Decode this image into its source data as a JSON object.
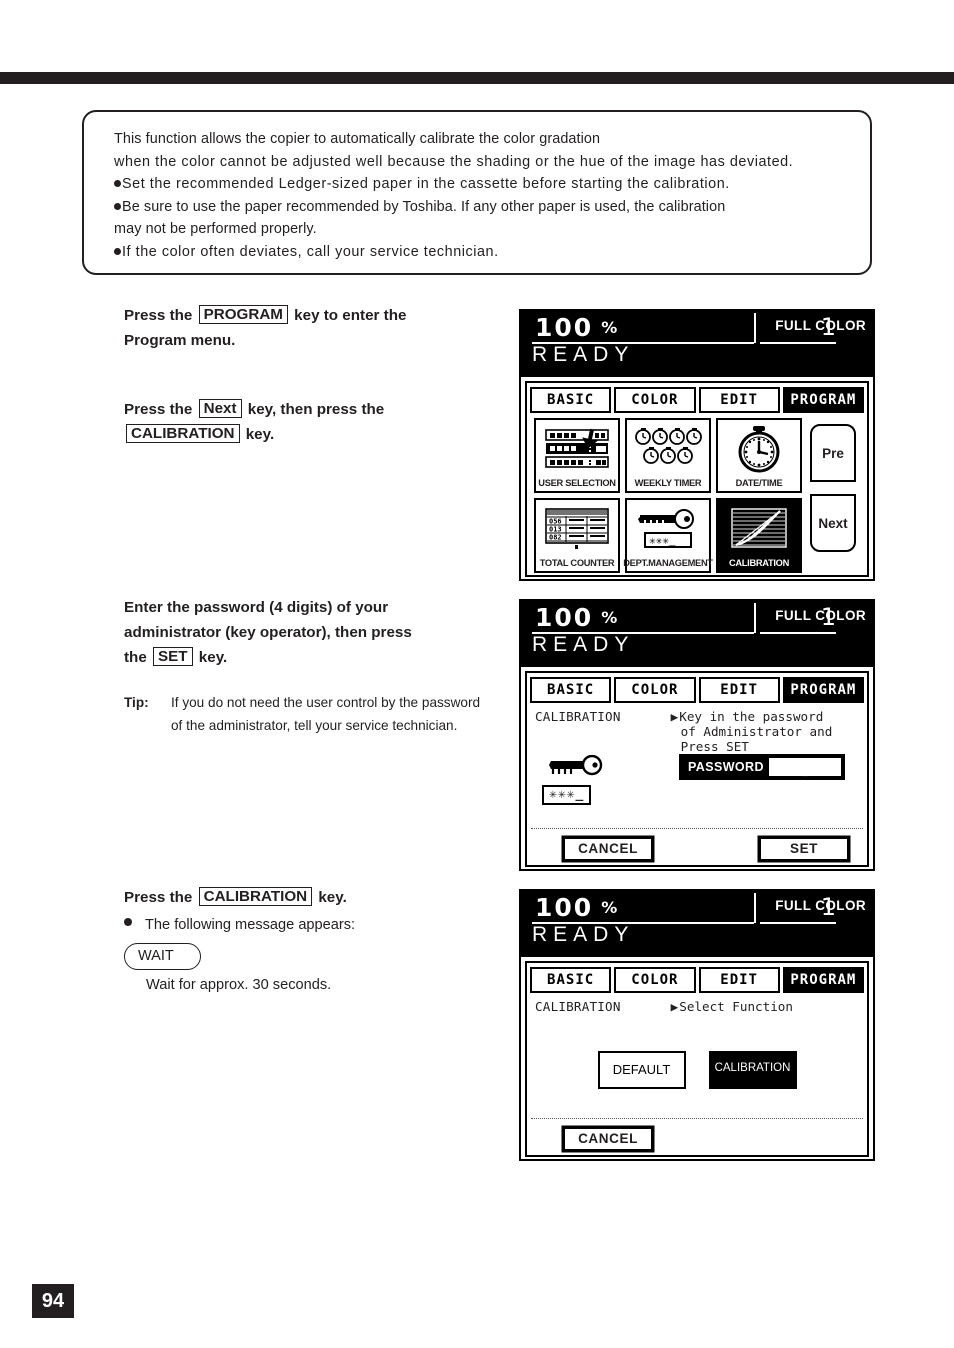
{
  "page": {
    "number": "94"
  },
  "intro": {
    "lines": [
      "This function allows the copier to automatically calibrate the color gradation",
      "when the color cannot be adjusted well because the shading or the hue of the image has deviated."
    ],
    "bullets": [
      "Set the recommended Ledger-sized paper in the cassette before starting the calibration.",
      "Be sure to use the paper recommended by Toshiba. If any other paper is used, the calibration",
      " may not be performed properly.",
      "If the color often deviates, call your service technician."
    ]
  },
  "steps": {
    "step1": {
      "pre": "Press  the",
      "key": "PROGRAM",
      "post": "key  to  enter  the",
      "line2": "Program menu."
    },
    "step2": {
      "pre": "Press  the",
      "key": "Next",
      "post": "key,  then  press  the",
      "key2": "CALIBRATION",
      "post2": "key."
    },
    "step3": {
      "line1": "Enter  the  password  (4  digits)  of  your",
      "line2": "administrator  (key  operator),  then  press",
      "line3_pre": "the",
      "line3_key": "SET",
      "line3_post": "key.",
      "tip_label": "Tip:",
      "tip_body": "If you do not need the user control by the password of the administrator, tell your service technician."
    },
    "step4": {
      "pre": "Press  the",
      "key": "CALIBRATION",
      "post": "key.",
      "bullet": "The  following  message  appears:",
      "wait_pill": "WAIT",
      "wait_note": "Wait  for  approx.  30  seconds."
    }
  },
  "lcd": {
    "common": {
      "zoom": "100",
      "percent": "%",
      "copies": "1",
      "color_mode": "FULL COLOR",
      "status": "READY",
      "tabs": [
        {
          "label": "BASIC",
          "active": false
        },
        {
          "label": "COLOR",
          "active": false
        },
        {
          "label": "EDIT",
          "active": false
        },
        {
          "label": "PROGRAM",
          "active": true
        }
      ]
    },
    "panel1": {
      "cells": [
        {
          "label": "USER SELECTION",
          "icon": "user-selection-icon",
          "selected": false
        },
        {
          "label": "WEEKLY TIMER",
          "icon": "weekly-timer-icon",
          "selected": false
        },
        {
          "label": "DATE/TIME",
          "icon": "date-time-icon",
          "selected": false
        },
        {
          "label": "TOTAL COUNTER",
          "icon": "total-counter-icon",
          "selected": false
        },
        {
          "label": "DEPT.MANAGEMENT",
          "icon": "dept-management-icon",
          "selected": false
        },
        {
          "label": "CALIBRATION",
          "icon": "calibration-icon",
          "selected": true
        }
      ],
      "counter_values": [
        "056",
        "013",
        "082"
      ],
      "dept_mask": "✳✳✳_",
      "nav": {
        "prev": "Pre",
        "next": "Next"
      }
    },
    "panel2": {
      "title": "CALIBRATION",
      "message": [
        "Key in the password",
        "of Administrator and",
        "Press SET"
      ],
      "stars": "✳✳✳_",
      "password_label": "PASSWORD",
      "password_value": "_",
      "cancel": "CANCEL",
      "set": "SET"
    },
    "panel3": {
      "title": "CALIBRATION",
      "message": "Select Function",
      "buttons": [
        {
          "label": "DEFAULT",
          "selected": false
        },
        {
          "label": "CALIBRATION",
          "selected": true
        }
      ],
      "cancel": "CANCEL"
    }
  }
}
